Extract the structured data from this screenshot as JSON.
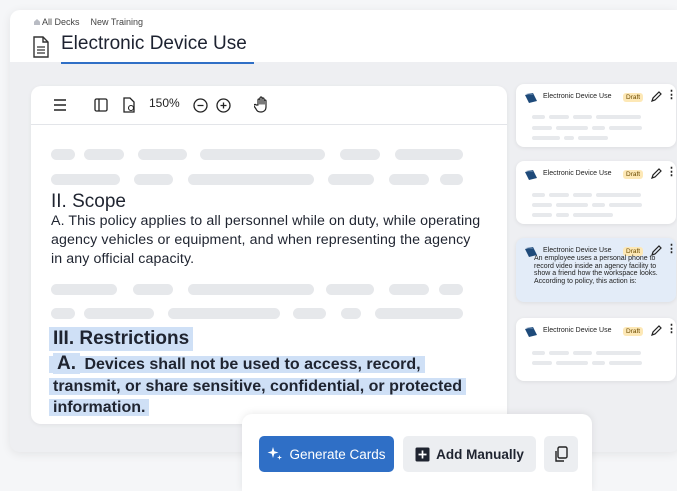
{
  "breadcrumb": [
    "All Decks",
    "New Training"
  ],
  "page": {
    "title": "Electronic Device Use"
  },
  "toolbar": {
    "zoom": "150%"
  },
  "document": {
    "scope_heading": "II. Scope",
    "scope_text": "A. This policy applies to all personnel while on duty, while operating agency vehicles or equipment, and when representing the agency in any official capacity.",
    "restrictions_heading": "III. Restrictions",
    "restriction_letter": "A.",
    "restriction_text": "Devices shall not be used to access, record, transmit, or share sensitive, confidential, or protected information."
  },
  "cards": [
    {
      "title": "Electronic Device Use",
      "badge": "Draft",
      "preview": ""
    },
    {
      "title": "Electronic Device Use",
      "badge": "Draft",
      "preview": ""
    },
    {
      "title": "Electronic Device Use",
      "badge": "Draft",
      "preview": "An employee uses a personal phone to record video inside an agency facility to show a friend how the workspace looks. According to policy, this action is:"
    },
    {
      "title": "Electronic Device Use",
      "badge": "Draft",
      "preview": ""
    }
  ],
  "actions": {
    "generate": "Generate Cards",
    "add_manually": "Add Manually"
  },
  "colors": {
    "accent": "#2f6fc6",
    "selection": "#cfe0f6",
    "draft_badge": "#fde8b6"
  },
  "icons": [
    "document-icon",
    "menu-icon",
    "sidebar-panel-icon",
    "page-settings-icon",
    "zoom-out-icon",
    "zoom-in-icon",
    "hand-pan-icon",
    "deck-icon",
    "pencil-icon",
    "more-vertical-icon",
    "sparkle-icon",
    "plus-square-icon",
    "copy-icon"
  ]
}
